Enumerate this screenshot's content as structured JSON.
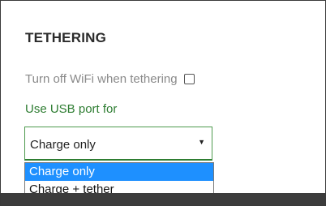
{
  "section": {
    "title": "TETHERING"
  },
  "wifi_setting": {
    "label": "Turn off WiFi when tethering",
    "checked": false
  },
  "usb_setting": {
    "label": "Use USB port for",
    "selected_value": "Charge only",
    "arrow": "▼",
    "options": [
      {
        "label": "Charge only",
        "highlighted": true
      },
      {
        "label": "Charge + tether",
        "highlighted": false
      }
    ]
  },
  "colors": {
    "accent_green": "#2e7d32",
    "highlight_blue": "#1e90ff",
    "muted_text": "#8a8a8a"
  }
}
